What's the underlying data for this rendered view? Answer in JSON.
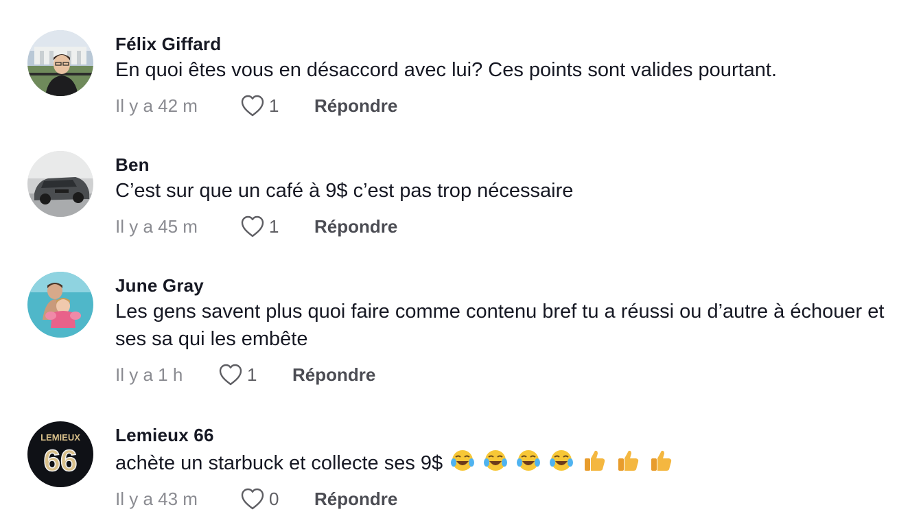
{
  "comments": [
    {
      "username": "Félix Giffard",
      "text": "En quoi êtes vous en désaccord avec lui? Ces points sont valides pourtant.",
      "time": "Il y a 42 m",
      "likes": "1",
      "reply_label": "Répondre",
      "avatar_icon": "avatar-white-house-photo"
    },
    {
      "username": "Ben",
      "text": "C’est sur que un café à 9$ c’est pas trop nécessaire",
      "time": "Il y a 45 m",
      "likes": "1",
      "reply_label": "Répondre",
      "avatar_icon": "avatar-car-photo"
    },
    {
      "username": "June Gray",
      "text": "Les gens savent plus quoi faire comme contenu bref tu a réussi ou d’autre à échouer et ses sa qui les embête",
      "time": "Il y a 1 h",
      "likes": "1",
      "reply_label": "Répondre",
      "avatar_icon": "avatar-pool-photo"
    },
    {
      "username": "Lemieux 66",
      "text": "achète un starbuck et collecte ses 9$",
      "emojis": [
        "joy-emoji",
        "joy-emoji",
        "joy-emoji",
        "joy-emoji",
        "thumbs-up-emoji",
        "thumbs-up-emoji",
        "thumbs-up-emoji"
      ],
      "time": "Il y a 43 m",
      "likes": "0",
      "reply_label": "Répondre",
      "avatar_icon": "avatar-jersey-lemieux-66",
      "avatar_text": "LEMIEUX",
      "avatar_number": "66"
    }
  ],
  "colors": {
    "text": "#161823",
    "secondary": "#8a8b91",
    "reply": "#4b4c53"
  }
}
